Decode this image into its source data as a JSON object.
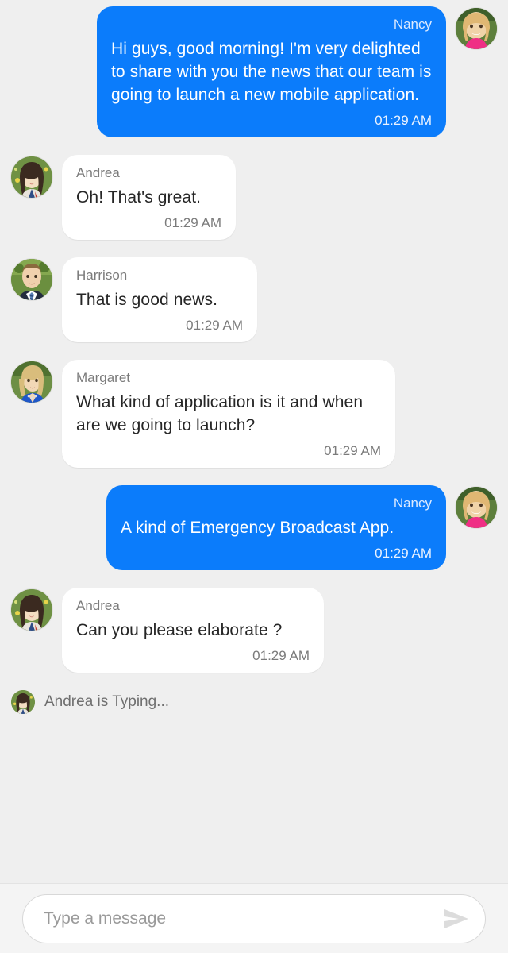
{
  "theme": {
    "background": "#efefef",
    "outgoing_bubble": "#0b7cfb",
    "incoming_bubble": "#ffffff",
    "text_primary": "#262626",
    "text_secondary": "#7b7b7b",
    "composer_background": "#f4f4f4"
  },
  "messages": [
    {
      "sender": "Nancy",
      "text": "Hi guys, good morning! I'm very delighted to share with you the news that our team is going to launch a new mobile application.",
      "time": "01:29 AM",
      "direction": "outgoing",
      "avatar": "nancy"
    },
    {
      "sender": "Andrea",
      "text": "Oh! That's great.",
      "time": "01:29 AM",
      "direction": "incoming",
      "avatar": "andrea"
    },
    {
      "sender": "Harrison",
      "text": "That is good news.",
      "time": "01:29 AM",
      "direction": "incoming",
      "avatar": "harrison"
    },
    {
      "sender": "Margaret",
      "text": "What kind of application is it and when are we going to launch?",
      "time": "01:29 AM",
      "direction": "incoming",
      "avatar": "margaret"
    },
    {
      "sender": "Nancy",
      "text": "A kind of Emergency Broadcast App.",
      "time": "01:29 AM",
      "direction": "outgoing",
      "avatar": "nancy"
    },
    {
      "sender": "Andrea",
      "text": "Can you please elaborate ?",
      "time": "01:29 AM",
      "direction": "incoming",
      "avatar": "andrea"
    }
  ],
  "typing_indicator": {
    "label": "Andrea is Typing...",
    "avatar": "andrea"
  },
  "composer": {
    "placeholder": "Type a message",
    "value": "",
    "send_icon": "send-icon"
  }
}
